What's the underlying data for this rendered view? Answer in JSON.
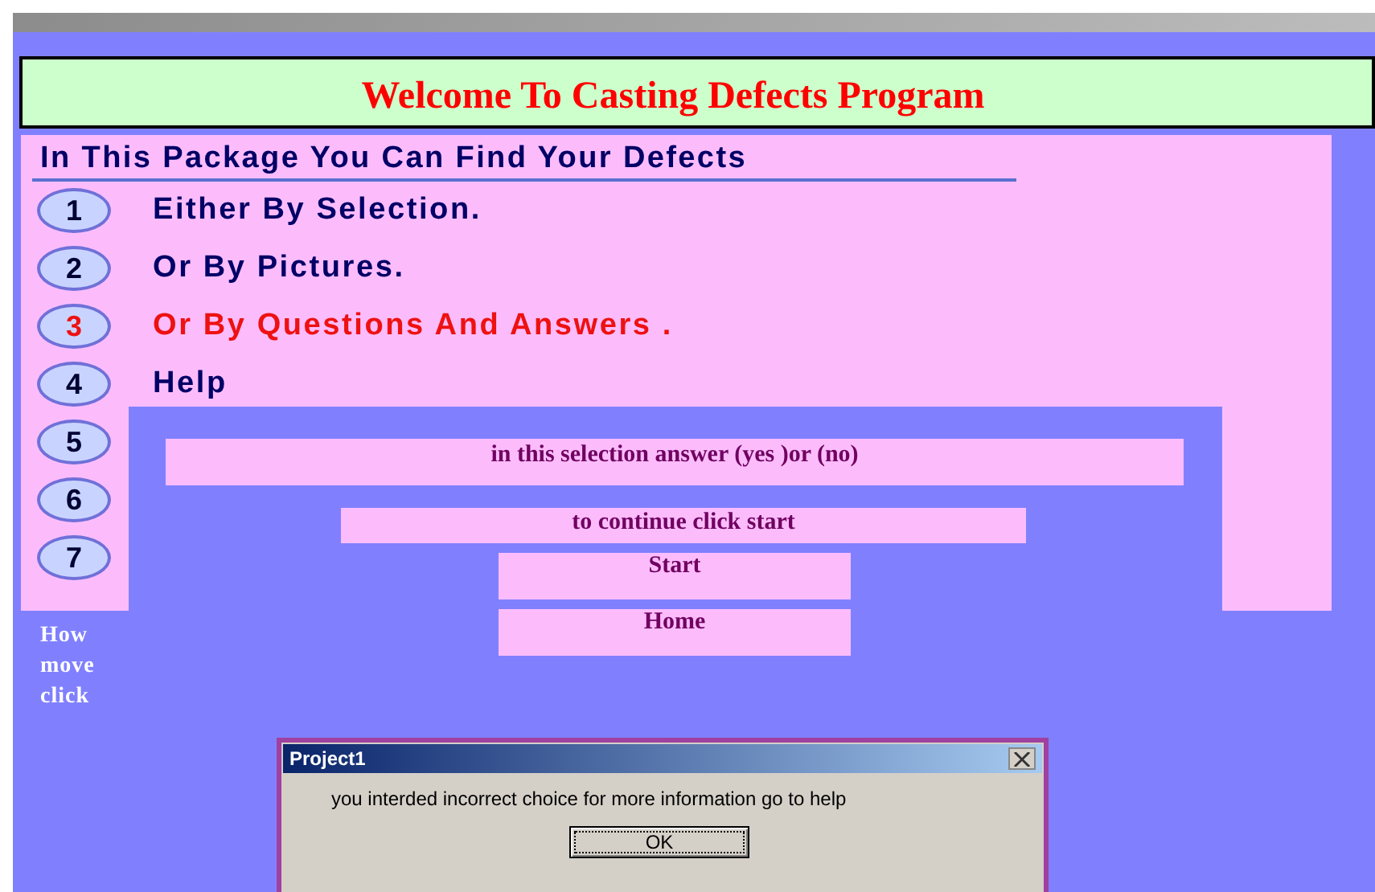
{
  "title": "Welcome To Casting Defects Program",
  "package": {
    "heading": "In This Package You Can Find Your Defects",
    "items": [
      {
        "number": "1",
        "label": "Either By Selection.",
        "selected": false
      },
      {
        "number": "2",
        "label": "Or By Pictures.",
        "selected": false
      },
      {
        "number": "3",
        "label": "Or By Questions And Answers .",
        "selected": true
      },
      {
        "number": "4",
        "label": "Help",
        "selected": false
      },
      {
        "number": "5",
        "selected": false
      },
      {
        "number": "6",
        "selected": false
      },
      {
        "number": "7",
        "selected": false
      }
    ]
  },
  "side_notes": [
    "How",
    "move",
    "click"
  ],
  "overlay": {
    "instruction": "in this selection answer (yes )or (no)",
    "hint": "to continue click start",
    "buttons": [
      "Start",
      "Home"
    ]
  },
  "dialog": {
    "title": "Project1",
    "message": "you interded incorrect choice for more information go to help",
    "button": "OK"
  }
}
